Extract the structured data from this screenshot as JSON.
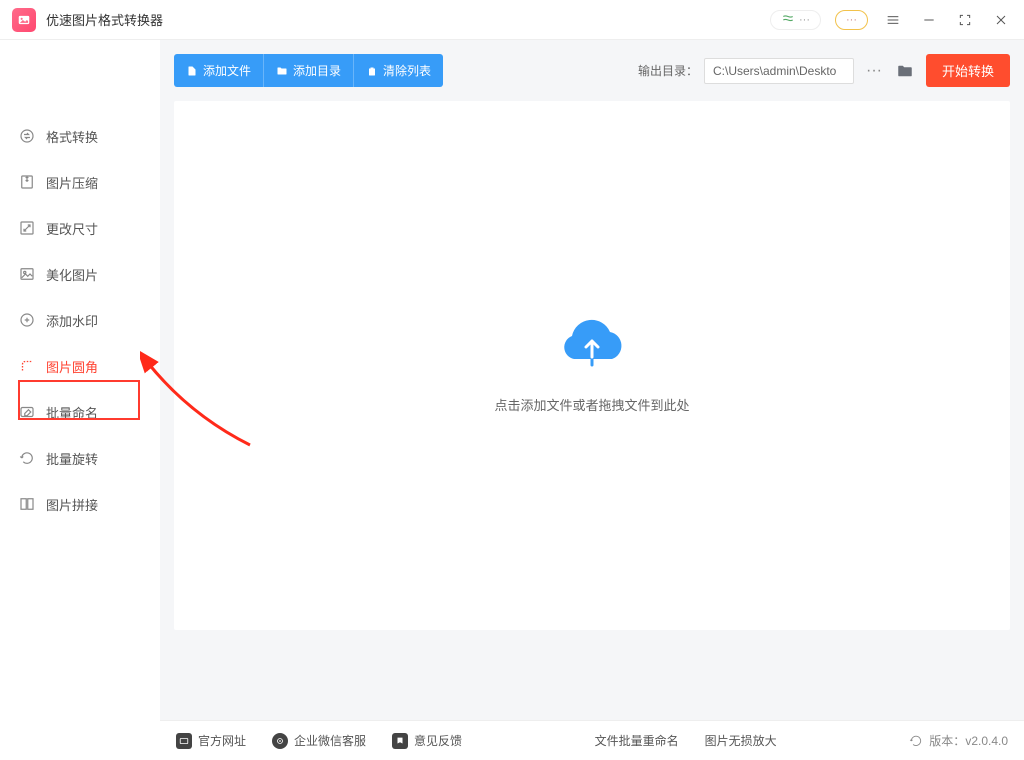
{
  "app": {
    "title": "优速图片格式转换器"
  },
  "sidebar": {
    "items": [
      {
        "label": "格式转换"
      },
      {
        "label": "图片压缩"
      },
      {
        "label": "更改尺寸"
      },
      {
        "label": "美化图片"
      },
      {
        "label": "添加水印"
      },
      {
        "label": "图片圆角"
      },
      {
        "label": "批量命名"
      },
      {
        "label": "批量旋转"
      },
      {
        "label": "图片拼接"
      }
    ]
  },
  "toolbar": {
    "add_file": "添加文件",
    "add_dir": "添加目录",
    "clear_list": "清除列表",
    "output_label": "输出目录：",
    "output_path": "C:\\Users\\admin\\Deskto",
    "start": "开始转换"
  },
  "drop": {
    "text": "点击添加文件或者拖拽文件到此处"
  },
  "footer": {
    "site": "官方网址",
    "wechat": "企业微信客服",
    "feedback": "意见反馈",
    "rename": "文件批量重命名",
    "enlarge": "图片无损放大",
    "version_label": "版本：",
    "version": "v2.0.4.0"
  }
}
